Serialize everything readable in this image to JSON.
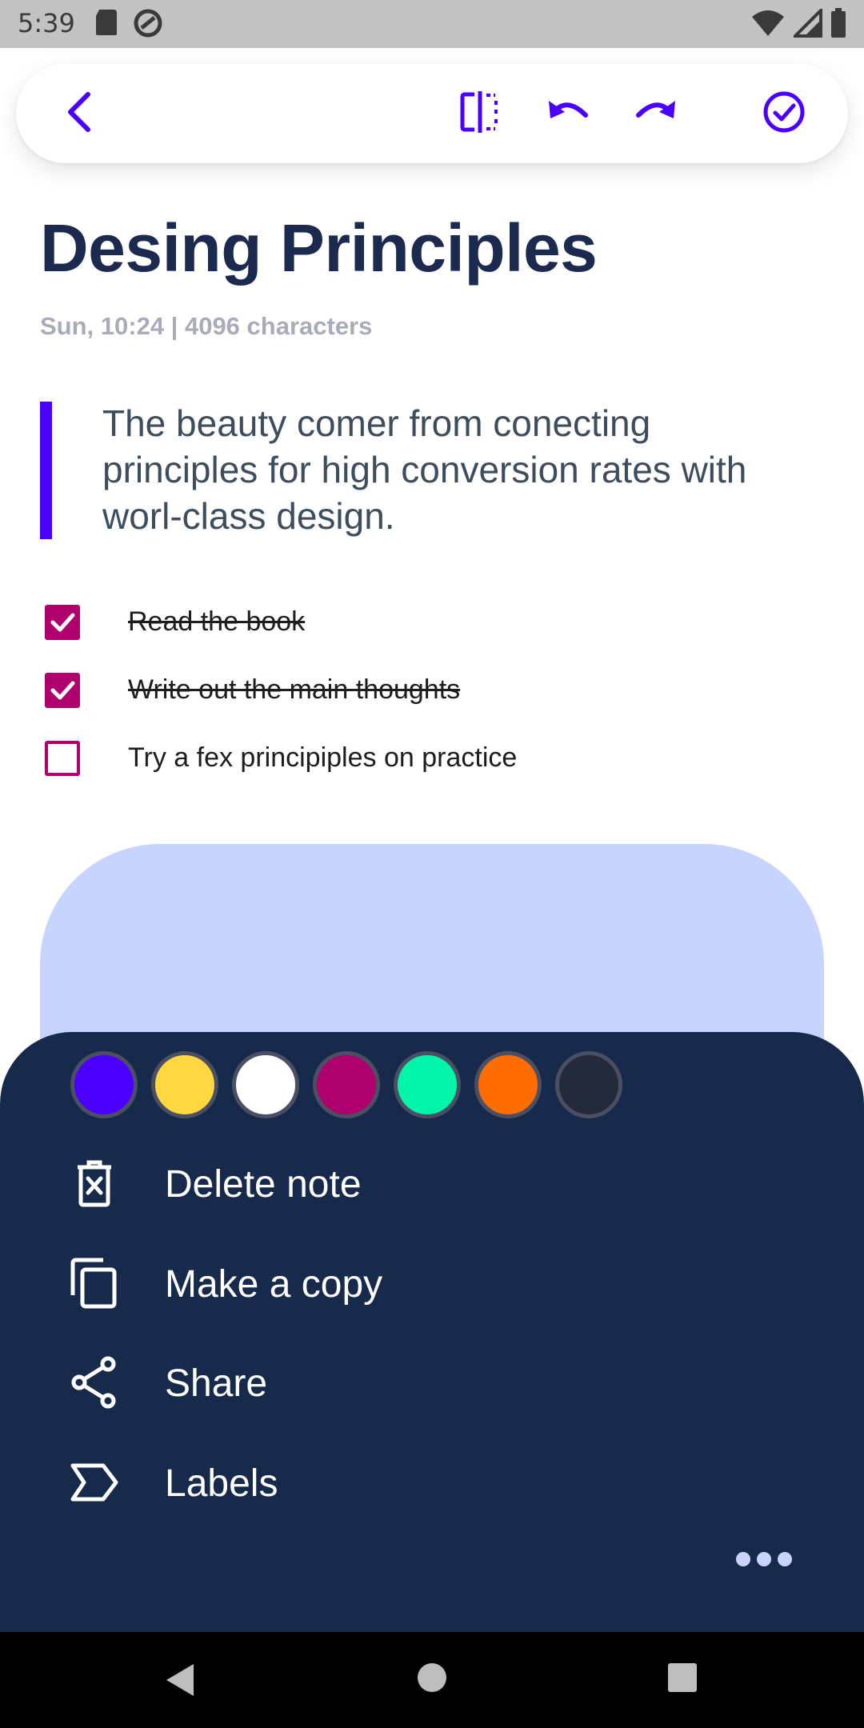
{
  "status_bar": {
    "time": "5:39",
    "left_icons": [
      "sd-card-icon",
      "sync-icon"
    ],
    "right_icons": [
      "wifi-icon",
      "signal-icon",
      "battery-icon"
    ]
  },
  "toolbar": {
    "icons": [
      "back-icon",
      "split-view-icon",
      "undo-icon",
      "redo-icon",
      "done-check-icon"
    ],
    "accent": "#4b00ff"
  },
  "note": {
    "title": "Desing Principles",
    "meta": "Sun, 10:24 | 4096 characters",
    "quote": "The beauty comer from conecting principles for high conversion rates with worl-class design.",
    "tasks": [
      {
        "label": "Read the book",
        "checked": true
      },
      {
        "label": "Write out the main thoughts",
        "checked": true
      },
      {
        "label": "Try a fex principiples on practice",
        "checked": false
      }
    ],
    "image_color": "#c6d4ff"
  },
  "sheet": {
    "background": "#172a4b",
    "colors": [
      "#4b00ff",
      "#ffd740",
      "#ffffff",
      "#b0006e",
      "#00f5a8",
      "#ff6d00",
      "#222a3c"
    ],
    "menu": [
      {
        "label": "Delete note",
        "icon": "delete-icon"
      },
      {
        "label": "Make a copy",
        "icon": "copy-icon"
      },
      {
        "label": "Share",
        "icon": "share-icon"
      },
      {
        "label": "Labels",
        "icon": "label-icon"
      }
    ],
    "more_icon": "more-horizontal-icon"
  },
  "nav_bar": {
    "icons": [
      "nav-back-icon",
      "nav-home-icon",
      "nav-recents-icon"
    ]
  }
}
